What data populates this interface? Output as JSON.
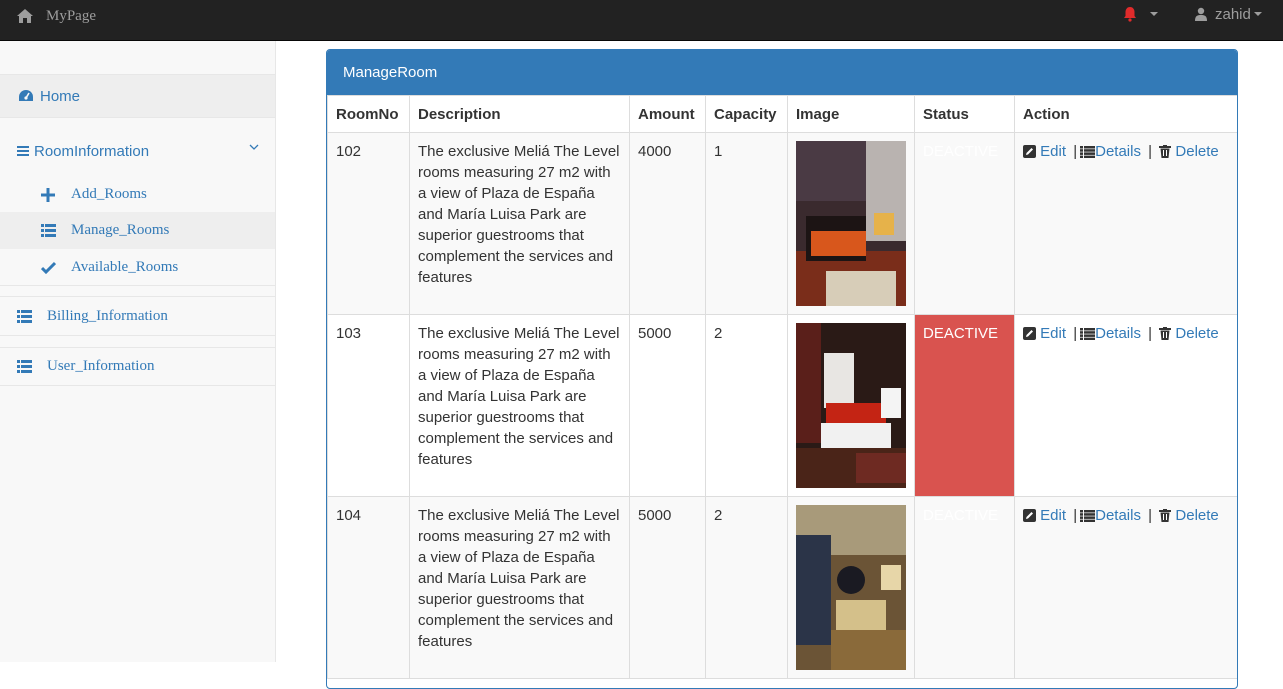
{
  "navbar": {
    "brand": "MyPage",
    "brand_icon": "home-icon",
    "user_name": "zahid",
    "bell_color": "#e02b2b"
  },
  "sidebar": {
    "home": "Home",
    "room_information": "RoomInformation",
    "sub_items": {
      "add_rooms": "Add_Rooms",
      "manage_rooms": "Manage_Rooms",
      "available_rooms": "Available_Rooms"
    },
    "billing_information": "Billing_Information",
    "user_information": "User_Information"
  },
  "panel": {
    "title": "ManageRoom",
    "columns": [
      "RoomNo",
      "Description",
      "Amount",
      "Capacity",
      "Image",
      "Status",
      "Action"
    ],
    "rows": [
      {
        "room_no": "102",
        "description": "The exclusive Meliá The Level rooms measuring 27 m2 with a view of Plaza de España and María Luisa Park are superior guestrooms that complement the services and features",
        "amount": "4000",
        "capacity": "1",
        "status": "DEACTIVE"
      },
      {
        "room_no": "103",
        "description": "The exclusive Meliá The Level rooms measuring 27 m2 with a view of Plaza de España and María Luisa Park are superior guestrooms that complement the services and features",
        "amount": "5000",
        "capacity": "2",
        "status": "DEACTIVE"
      },
      {
        "room_no": "104",
        "description": "The exclusive Meliá The Level rooms measuring 27 m2 with a view of Plaza de España and María Luisa Park are superior guestrooms that complement the services and features",
        "amount": "5000",
        "capacity": "2",
        "status": "DEACTIVE"
      }
    ],
    "actions": {
      "edit": "Edit",
      "details": "Details",
      "delete": "Delete",
      "separator": "|"
    }
  },
  "colors": {
    "primary": "#337ab7",
    "danger": "#d9534f",
    "navbar": "#222222"
  }
}
